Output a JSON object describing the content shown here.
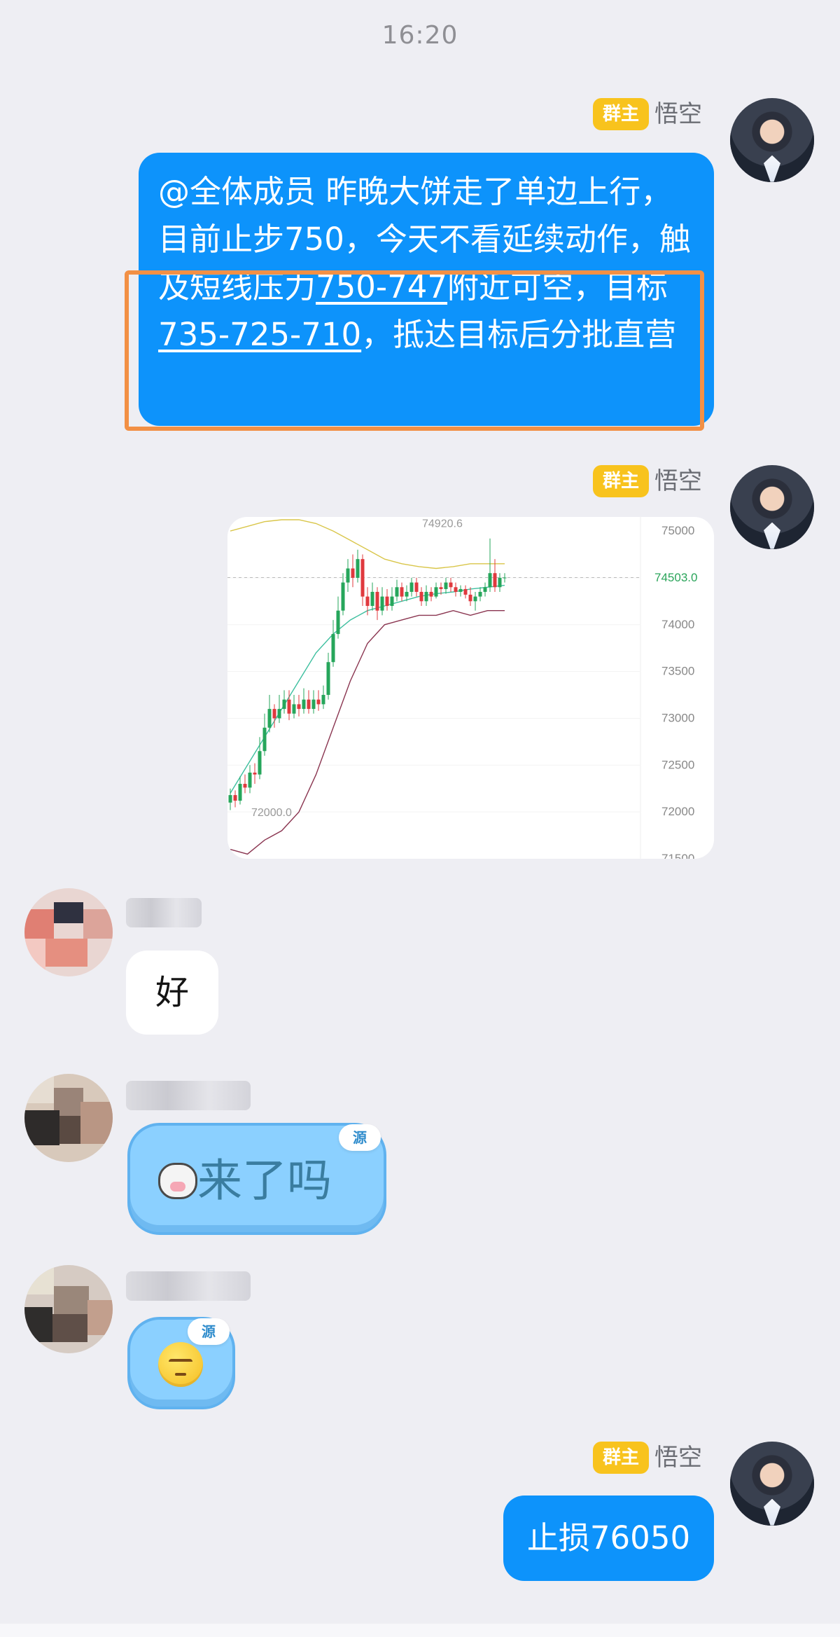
{
  "status": {
    "time": "16:20"
  },
  "owner": {
    "badge": "群主",
    "name": "悟空"
  },
  "messages": {
    "m1": {
      "part1": "@全体成员 昨晚大饼走了单边上行，目前止步750，今天不看延续动作，触及短线压力",
      "link1": "750-747",
      "part2": "附近可空，目标",
      "link2": "735-725-710",
      "part3": "，抵达目标后分批直营"
    },
    "m5": {
      "text": "止损76050"
    }
  },
  "chart_data": {
    "type": "candlestick",
    "ylim": [
      71500,
      75150
    ],
    "yticks": [
      75000,
      74500,
      74000,
      73500,
      73000,
      72500,
      72000,
      71500
    ],
    "ytick_labels": [
      "75000",
      "74503.0",
      "74000",
      "73500",
      "73000",
      "72500",
      "72000",
      "71500"
    ],
    "last_price": "74503.0",
    "high_label": "74920.6",
    "low_label": "72000.0",
    "colors": {
      "up": "#26a65b",
      "down": "#e0393e",
      "upper_band": "#d9c64a",
      "middle_band": "#3dbf9f",
      "lower_band": "#8a3550"
    },
    "candles": [
      [
        72100,
        72180,
        72020,
        72250
      ],
      [
        72180,
        72120,
        72050,
        72230
      ],
      [
        72120,
        72300,
        72080,
        72380
      ],
      [
        72300,
        72260,
        72200,
        72400
      ],
      [
        72260,
        72420,
        72200,
        72500
      ],
      [
        72420,
        72400,
        72300,
        72520
      ],
      [
        72400,
        72650,
        72350,
        72800
      ],
      [
        72650,
        72900,
        72600,
        73050
      ],
      [
        72900,
        73100,
        72850,
        73250
      ],
      [
        73100,
        73000,
        72900,
        73150
      ],
      [
        73000,
        73100,
        72950,
        73250
      ],
      [
        73100,
        73200,
        73050,
        73300
      ],
      [
        73200,
        73050,
        72980,
        73300
      ],
      [
        73050,
        73150,
        73000,
        73250
      ],
      [
        73150,
        73100,
        73020,
        73250
      ],
      [
        73100,
        73200,
        73050,
        73320
      ],
      [
        73200,
        73100,
        73050,
        73300
      ],
      [
        73100,
        73200,
        73050,
        73300
      ],
      [
        73200,
        73150,
        73080,
        73300
      ],
      [
        73150,
        73250,
        73100,
        73350
      ],
      [
        73250,
        73600,
        73200,
        73700
      ],
      [
        73600,
        73900,
        73550,
        74050
      ],
      [
        73900,
        74150,
        73850,
        74300
      ],
      [
        74150,
        74450,
        74100,
        74550
      ],
      [
        74450,
        74600,
        74350,
        74700
      ],
      [
        74600,
        74500,
        74400,
        74750
      ],
      [
        74500,
        74700,
        74450,
        74800
      ],
      [
        74700,
        74300,
        74200,
        74750
      ],
      [
        74300,
        74200,
        74100,
        74400
      ],
      [
        74200,
        74350,
        74150,
        74450
      ],
      [
        74350,
        74150,
        74050,
        74400
      ],
      [
        74150,
        74300,
        74100,
        74400
      ],
      [
        74300,
        74200,
        74150,
        74380
      ],
      [
        74200,
        74300,
        74150,
        74400
      ],
      [
        74300,
        74400,
        74250,
        74480
      ],
      [
        74400,
        74300,
        74250,
        74450
      ],
      [
        74300,
        74350,
        74250,
        74420
      ],
      [
        74350,
        74450,
        74300,
        74500
      ],
      [
        74450,
        74350,
        74300,
        74500
      ],
      [
        74350,
        74250,
        74200,
        74400
      ],
      [
        74250,
        74350,
        74200,
        74420
      ],
      [
        74350,
        74300,
        74250,
        74400
      ],
      [
        74300,
        74400,
        74280,
        74450
      ],
      [
        74400,
        74380,
        74320,
        74450
      ],
      [
        74380,
        74450,
        74330,
        74500
      ],
      [
        74450,
        74400,
        74350,
        74500
      ],
      [
        74400,
        74350,
        74300,
        74450
      ],
      [
        74350,
        74380,
        74300,
        74420
      ],
      [
        74380,
        74320,
        74280,
        74420
      ],
      [
        74320,
        74250,
        74200,
        74400
      ],
      [
        74250,
        74300,
        74150,
        74350
      ],
      [
        74300,
        74350,
        74250,
        74400
      ],
      [
        74350,
        74400,
        74300,
        74450
      ],
      [
        74400,
        74550,
        74350,
        74920
      ],
      [
        74550,
        74400,
        74350,
        74700
      ],
      [
        74400,
        74500,
        74350,
        74550
      ],
      [
        74500,
        74503,
        74450,
        74550
      ]
    ],
    "upper_band": [
      75000,
      75050,
      75100,
      75120,
      75120,
      75080,
      75000,
      74900,
      74800,
      74700,
      74650,
      74620,
      74600,
      74620,
      74650,
      74650,
      74650
    ],
    "middle_band": [
      72200,
      72500,
      72800,
      73100,
      73400,
      73700,
      73900,
      74050,
      74150,
      74200,
      74250,
      74300,
      74330,
      74350,
      74380,
      74400,
      74420
    ],
    "lower_band": [
      71600,
      71550,
      71700,
      71800,
      72000,
      72400,
      72900,
      73400,
      73800,
      74000,
      74050,
      74100,
      74100,
      74150,
      74100,
      74150,
      74150
    ]
  }
}
